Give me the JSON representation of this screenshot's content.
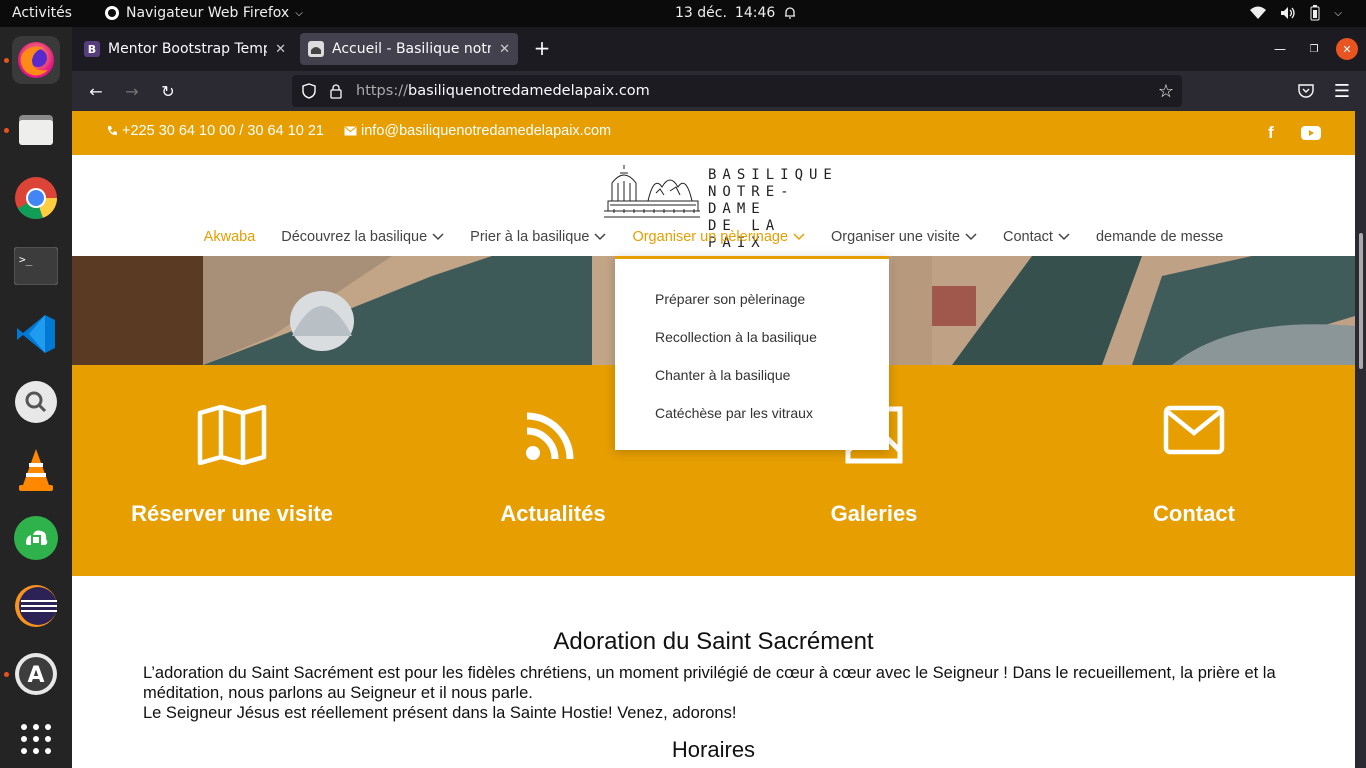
{
  "system": {
    "activities": "Activités",
    "app_name": "Navigateur Web Firefox",
    "date": "13 déc.",
    "time": "14:46"
  },
  "browser": {
    "tabs": [
      {
        "title": "Mentor Bootstrap Template",
        "icon": "bootstrap-icon"
      },
      {
        "title": "Accueil - Basilique notre dame",
        "icon": "basilique-favicon"
      }
    ],
    "url_prefix": "https://",
    "url_host": "basiliquenotredamedelapaix.com"
  },
  "site": {
    "phone": "+225 30 64 10 00 / 30 64 10 21",
    "email": "info@basiliquenotredamedelapaix.com",
    "logo_lines": [
      "BASILIQUE",
      "NOTRE-DAME",
      "DE LA PAIX"
    ],
    "nav": [
      {
        "label": "Akwaba",
        "active": true,
        "dropdown": false
      },
      {
        "label": "Découvrez la basilique",
        "active": false,
        "dropdown": true
      },
      {
        "label": "Prier à la basilique",
        "active": false,
        "dropdown": true
      },
      {
        "label": "Organiser un pèlerinage",
        "active": true,
        "dropdown": true
      },
      {
        "label": "Organiser une visite",
        "active": false,
        "dropdown": true
      },
      {
        "label": "Contact",
        "active": false,
        "dropdown": true
      },
      {
        "label": "demande de messe",
        "active": false,
        "dropdown": false
      }
    ],
    "dropdown_items": [
      "Préparer son pèlerinage",
      "Recollection à la basilique",
      "Chanter à la basilique",
      "Catéchèse par les vitraux"
    ],
    "features": [
      {
        "label": "Réserver une visite",
        "icon": "map-icon"
      },
      {
        "label": "Actualités",
        "icon": "rss-icon"
      },
      {
        "label": "Galeries",
        "icon": "image-icon"
      },
      {
        "label": "Contact",
        "icon": "envelope-icon"
      }
    ],
    "section_title": "Adoration du Saint Sacrément",
    "paragraph_1": "L’adoration du Saint Sacrément est pour les fidèles chrétiens, un moment privilégié de cœur à cœur avec le Seigneur ! Dans le recueillement, la prière et la méditation, nous parlons au Seigneur et il nous parle.",
    "paragraph_2": "Le Seigneur Jésus est réellement présent dans la Sainte Hostie! Venez, adorons!",
    "subtitle": "Horaires"
  },
  "colors": {
    "brand": "#e69e00",
    "firefox_tab_bg": "#42414d",
    "dock_bg": "#242424"
  }
}
